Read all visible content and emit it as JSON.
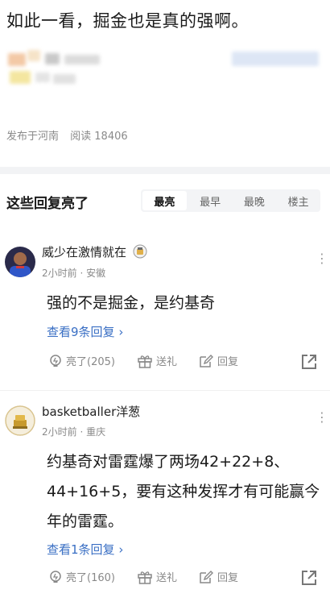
{
  "post": {
    "text": "如此一看，掘金也是真的强啊。",
    "meta_location": "发布于河南",
    "meta_reads": "阅读 18406"
  },
  "section": {
    "title": "这些回复亮了",
    "tabs": [
      "最亮",
      "最早",
      "最晚",
      "楼主"
    ]
  },
  "comments": [
    {
      "username": "威少在激情就在",
      "time_location": "2小时前 · 安徽",
      "text": "强的不是掘金，是约基奇",
      "view_replies": "查看9条回复",
      "likes": "亮了(205)",
      "gift": "送礼",
      "reply": "回复"
    },
    {
      "username": "basketballer洋葱",
      "time_location": "2小时前 · 重庆",
      "text": "约基奇对雷霆爆了两场42+22+8、44+16+5，要有这种发挥才有可能赢今年的雷霆。",
      "view_replies": "查看1条回复",
      "likes": "亮了(160)",
      "gift": "送礼",
      "reply": "回复"
    }
  ],
  "colors": {
    "link": "#3a6fc4",
    "muted": "#8a8a8a",
    "divider": "#f2f3f5"
  }
}
